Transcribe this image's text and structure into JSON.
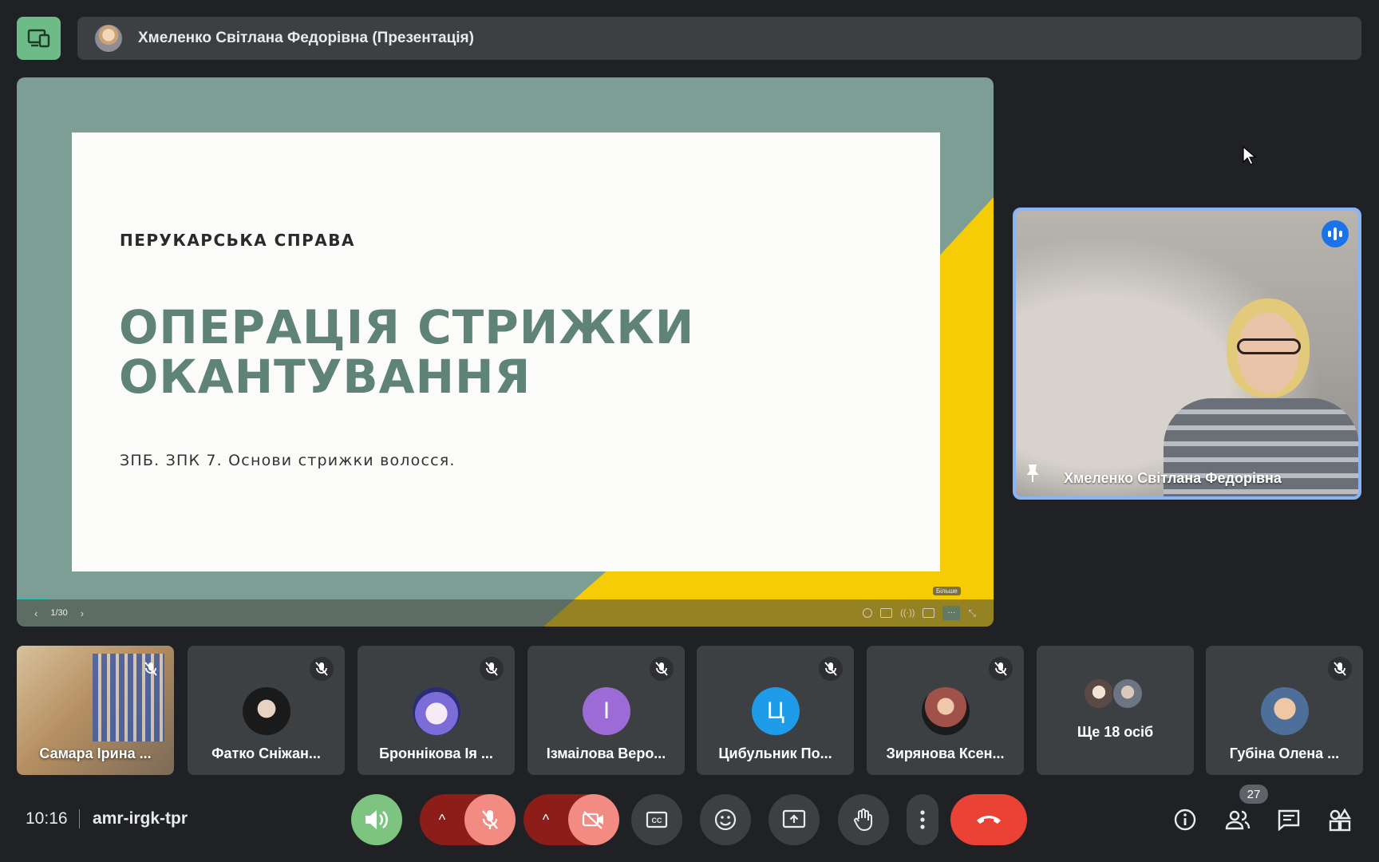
{
  "top_bar": {
    "presenter_title": "Хмеленко Світлана Федорівна (Презентація)"
  },
  "slide": {
    "kicker": "ПЕРУКАРСЬКА СПРАВА",
    "heading": "ОПЕРАЦІЯ СТРИЖКИ ОКАНТУВАННЯ",
    "subtitle": "ЗПБ. ЗПК 7. Основи стрижки волосся.",
    "page_indicator": "1/30",
    "prev_label": "‹",
    "next_label": "›",
    "tooltip": "Більше"
  },
  "speaker": {
    "name": "Хмеленко Світлана Федорівна"
  },
  "participants": [
    {
      "name": "Самара Ірина ...",
      "type": "video"
    },
    {
      "name": "Фатко Сніжан...",
      "type": "photo",
      "color": "#2b2b2b"
    },
    {
      "name": "Броннікова Ія ...",
      "type": "photo",
      "color": "#b9c7ff"
    },
    {
      "name": "Ізмаілова Веро...",
      "type": "letter",
      "letter": "І",
      "color": "#9c6bd6"
    },
    {
      "name": "Цибульник По...",
      "type": "letter",
      "letter": "Ц",
      "color": "#1e9be9"
    },
    {
      "name": "Зирянова Ксен...",
      "type": "photo",
      "color": "#a0524a"
    },
    {
      "name": "Ще 18 осіб",
      "type": "more"
    },
    {
      "name": "Губіна Олена ...",
      "type": "photo",
      "color": "#6f8fb4"
    }
  ],
  "bottom_bar": {
    "time": "10:16",
    "meeting_code": "amr-irgk-tpr",
    "people_count": "27"
  },
  "colors": {
    "accent_blue": "#8ab4f8",
    "end_call": "#ea4335",
    "mic_off": "#f28b82",
    "speaker_on": "#7cc47f",
    "slide_teal": "#5f8377",
    "slide_yellow": "#f5cc05"
  },
  "icons": {
    "present": "present-screen-icon",
    "volume": "volume-icon",
    "mic": "mic-off-icon",
    "camera": "camera-off-icon",
    "captions": "captions-icon",
    "emoji": "emoji-icon",
    "present_now": "present-now-icon",
    "hand": "raise-hand-icon",
    "more": "more-vert-icon",
    "end": "end-call-icon",
    "info": "info-icon",
    "people": "people-icon",
    "chat": "chat-icon",
    "activities": "activities-icon"
  }
}
